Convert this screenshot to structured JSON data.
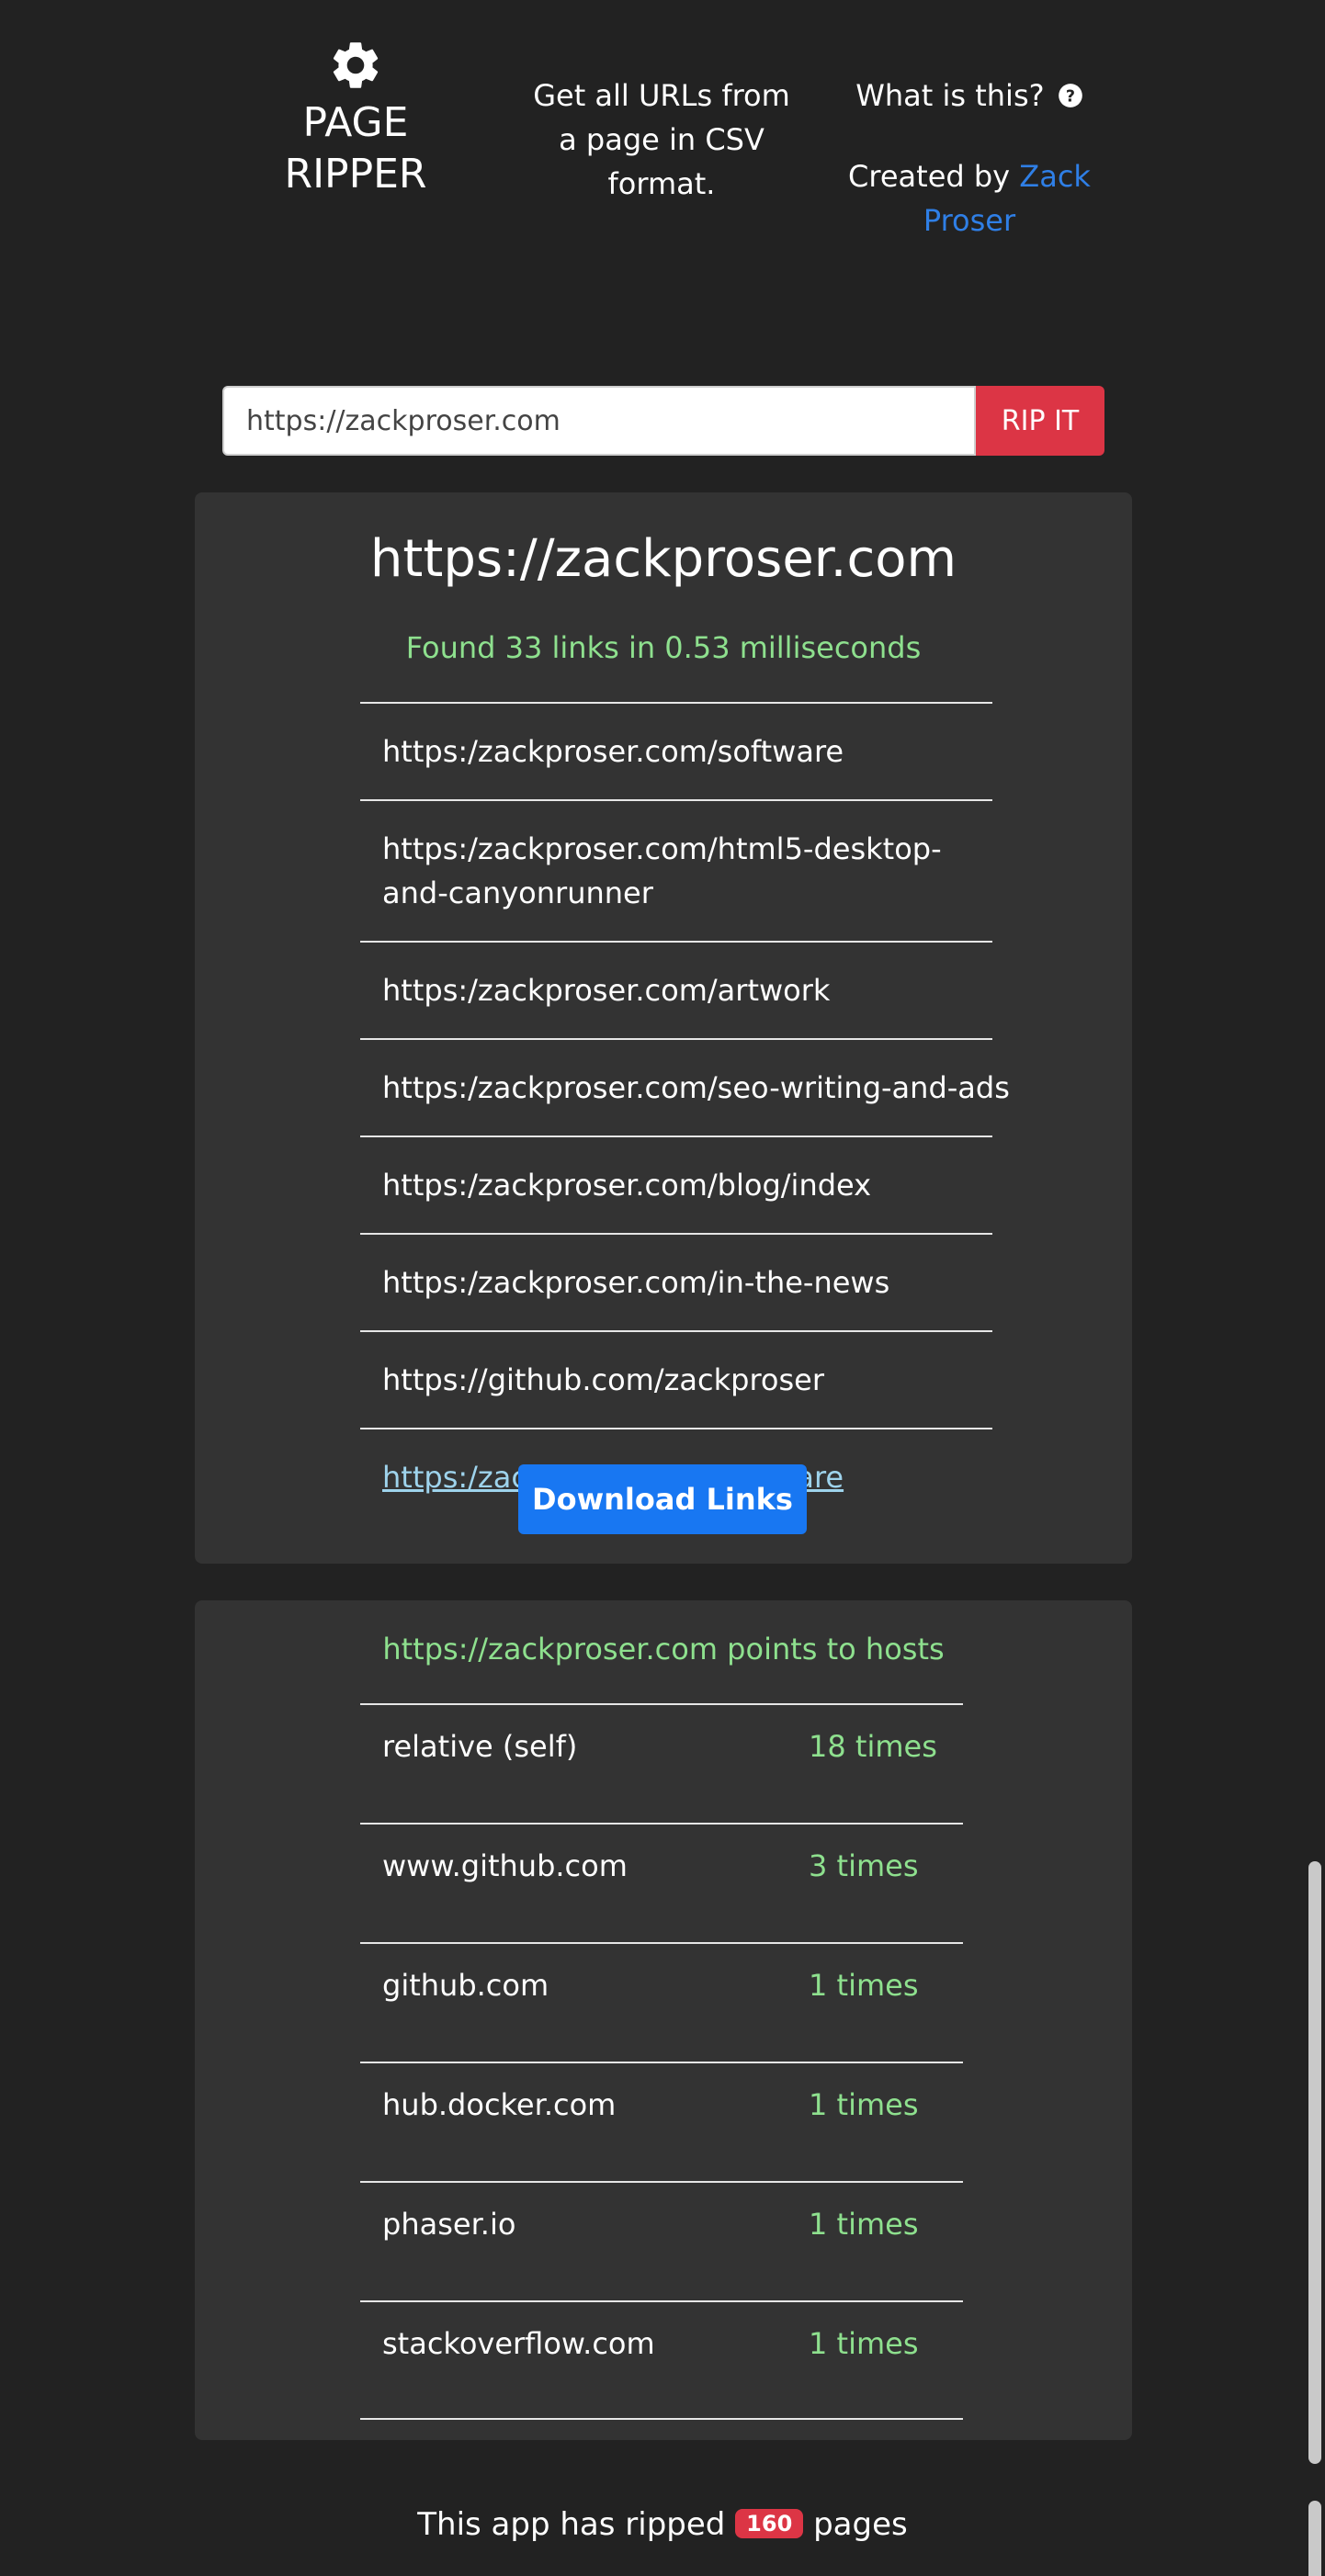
{
  "header": {
    "title_line1": "PAGE",
    "title_line2": "RIPPER",
    "tagline": "Get all URLs from a page in CSV format.",
    "about_label": "What is this?",
    "created_by_prefix": "Created by ",
    "author_link": "Zack Proser"
  },
  "search": {
    "value": "https://zackproser.com",
    "button_label": "RIP IT"
  },
  "results": {
    "title": "https://zackproser.com",
    "summary": "Found 33 links in 0.53 milliseconds",
    "links": [
      "https:/zackproser.com/software",
      "https:/zackproser.com/html5-desktop-and-canyonrunner",
      "https:/zackproser.com/artwork",
      "https:/zackproser.com/seo-writing-and-ads",
      "https:/zackproser.com/blog/index",
      "https:/zackproser.com/in-the-news",
      "https://github.com/zackproser",
      "https:/zackproser.com/software"
    ],
    "download_label": "Download Links"
  },
  "hosts": {
    "title": "https://zackproser.com points to hosts",
    "rows": [
      {
        "host": "relative (self)",
        "count": "18 times"
      },
      {
        "host": "www.github.com",
        "count": "3 times"
      },
      {
        "host": "github.com",
        "count": "1 times"
      },
      {
        "host": "hub.docker.com",
        "count": "1 times"
      },
      {
        "host": "phaser.io",
        "count": "1 times"
      },
      {
        "host": "stackoverflow.com",
        "count": "1 times"
      }
    ]
  },
  "footer": {
    "prefix": "This app has ripped ",
    "count": "160",
    "suffix": " pages"
  },
  "colors": {
    "background": "#222222",
    "panel": "#333333",
    "accent_green": "#8ee08e",
    "danger": "#dc3545",
    "primary": "#1877f2",
    "link_blue": "#2f7fe6"
  },
  "icons": [
    "gear-icon",
    "question-circle-icon"
  ]
}
